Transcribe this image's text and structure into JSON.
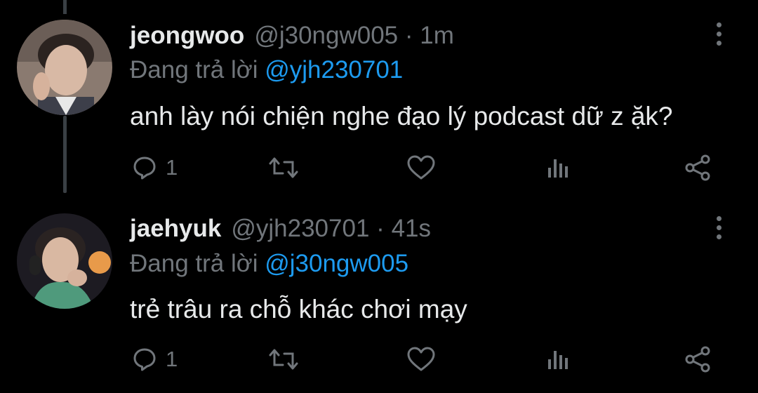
{
  "colors": {
    "background": "#000000",
    "text": "#e7e9ea",
    "muted": "#71767b",
    "accent": "#1d9bf0",
    "thread_line": "#3a3f44"
  },
  "tweets": [
    {
      "display_name": "jeongwoo",
      "handle": "@j30ngw005",
      "separator": "·",
      "time": "1m",
      "reply_prefix": "Đang trả lời",
      "reply_to": "@yjh230701",
      "text": "anh lày nói chiện nghe đạo lý podcast dữ z ặk?",
      "reply_count": "1",
      "icons": [
        "reply-icon",
        "retweet-icon",
        "like-icon",
        "views-icon",
        "share-icon",
        "more-icon"
      ]
    },
    {
      "display_name": "jaehyuk",
      "handle": "@yjh230701",
      "separator": "·",
      "time": "41s",
      "reply_prefix": "Đang trả lời",
      "reply_to": "@j30ngw005",
      "text": "trẻ trâu ra chỗ khác chơi mạy",
      "reply_count": "1",
      "icons": [
        "reply-icon",
        "retweet-icon",
        "like-icon",
        "views-icon",
        "share-icon",
        "more-icon"
      ]
    }
  ]
}
